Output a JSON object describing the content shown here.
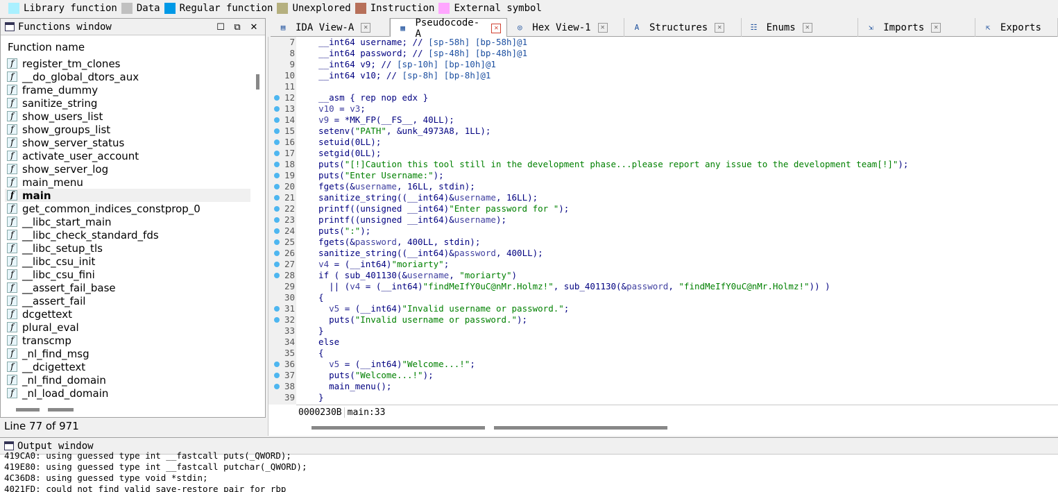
{
  "legend": [
    {
      "label": "Library function",
      "color": "#a9f0ff"
    },
    {
      "label": "Data",
      "color": "#c0c0c0"
    },
    {
      "label": "Regular function",
      "color": "#0099e6"
    },
    {
      "label": "Unexplored",
      "color": "#b5b07f"
    },
    {
      "label": "Instruction",
      "color": "#b7705a"
    },
    {
      "label": "External symbol",
      "color": "#ffa6ff"
    }
  ],
  "functions_window": {
    "title": "Functions window",
    "column_header": "Function name",
    "selected": "main",
    "items": [
      "register_tm_clones",
      "__do_global_dtors_aux",
      "frame_dummy",
      "sanitize_string",
      "show_users_list",
      "show_groups_list",
      "show_server_status",
      "activate_user_account",
      "show_server_log",
      "main_menu",
      "main",
      "get_common_indices_constprop_0",
      "__libc_start_main",
      "__libc_check_standard_fds",
      "__libc_setup_tls",
      "__libc_csu_init",
      "__libc_csu_fini",
      "__assert_fail_base",
      "__assert_fail",
      "dcgettext",
      "plural_eval",
      "transcmp",
      "_nl_find_msg",
      "__dcigettext",
      "_nl_find_domain",
      "_nl_load_domain"
    ],
    "status": "Line 77 of 971"
  },
  "tabs": [
    {
      "label": "IDA View-A",
      "icon": "ida-view-icon",
      "glyph": "▤",
      "active": false
    },
    {
      "label": "Pseudocode-A",
      "icon": "pseudocode-icon",
      "glyph": "▦",
      "active": true
    },
    {
      "label": "Hex View-1",
      "icon": "hex-view-icon",
      "glyph": "◎",
      "active": false
    },
    {
      "label": "Structures",
      "icon": "structures-icon",
      "glyph": "A",
      "active": false
    },
    {
      "label": "Enums",
      "icon": "enums-icon",
      "glyph": "☷",
      "active": false
    },
    {
      "label": "Imports",
      "icon": "imports-icon",
      "glyph": "⇲",
      "active": false
    },
    {
      "label": "Exports",
      "icon": "exports-icon",
      "glyph": "⇱",
      "active": false
    }
  ],
  "code": {
    "lines": [
      {
        "n": "7",
        "dot": false,
        "html": "  <span class='kw'>__int64 username; // </span><span class='cm'>[sp-58h] [bp-58h]@1</span>"
      },
      {
        "n": "8",
        "dot": false,
        "html": "  <span class='kw'>__int64 password; // </span><span class='cm'>[sp-48h] [bp-48h]@1</span>"
      },
      {
        "n": "9",
        "dot": false,
        "html": "  <span class='kw'>__int64 v9; // </span><span class='cm'>[sp-10h] [bp-10h]@1</span>"
      },
      {
        "n": "10",
        "dot": false,
        "html": "  <span class='kw'>__int64 v10; // </span><span class='cm'>[sp-8h] [bp-8h]@1</span>"
      },
      {
        "n": "11",
        "dot": false,
        "html": ""
      },
      {
        "n": "12",
        "dot": true,
        "html": "  __asm { rep nop edx }"
      },
      {
        "n": "13",
        "dot": true,
        "html": "  <span class='var'>v10</span> = <span class='var'>v3</span>;"
      },
      {
        "n": "14",
        "dot": true,
        "html": "  <span class='var'>v9</span> = *MK_FP(__FS__, 40LL);"
      },
      {
        "n": "15",
        "dot": true,
        "html": "  setenv(<span class='str'>\"PATH\"</span>, &amp;unk_4973A8, 1LL);"
      },
      {
        "n": "16",
        "dot": true,
        "html": "  setuid(0LL);"
      },
      {
        "n": "17",
        "dot": true,
        "html": "  setgid(0LL);"
      },
      {
        "n": "18",
        "dot": true,
        "html": "  puts(<span class='str'>\"[!]Caution this tool still in the development phase...please report any issue to the development team[!]\"</span>);"
      },
      {
        "n": "19",
        "dot": true,
        "html": "  puts(<span class='str'>\"Enter Username:\"</span>);"
      },
      {
        "n": "20",
        "dot": true,
        "html": "  fgets(&amp;<span class='var'>username</span>, 16LL, stdin);"
      },
      {
        "n": "21",
        "dot": true,
        "html": "  sanitize_string((__int64)&amp;<span class='var'>username</span>, 16LL);"
      },
      {
        "n": "22",
        "dot": true,
        "html": "  printf((unsigned __int64)<span class='str'>\"Enter password for \"</span>);"
      },
      {
        "n": "23",
        "dot": true,
        "html": "  printf((unsigned __int64)&amp;<span class='var'>username</span>);"
      },
      {
        "n": "24",
        "dot": true,
        "html": "  puts(<span class='str'>\":\"</span>);"
      },
      {
        "n": "25",
        "dot": true,
        "html": "  fgets(&amp;<span class='var'>password</span>, 400LL, stdin);"
      },
      {
        "n": "26",
        "dot": true,
        "html": "  sanitize_string((__int64)&amp;<span class='var'>password</span>, 400LL);"
      },
      {
        "n": "27",
        "dot": true,
        "html": "  <span class='var'>v4</span> = (__int64)<span class='str'>\"moriarty\"</span>;"
      },
      {
        "n": "28",
        "dot": true,
        "html": "  if ( sub_401130(&amp;<span class='var'>username</span>, <span class='str'>\"moriarty\"</span>)"
      },
      {
        "n": "29",
        "dot": false,
        "html": "    || (<span class='var'>v4</span> = (__int64)<span class='str'>\"findMeIfY0uC@nMr.Holmz!\"</span>, sub_401130(&amp;<span class='var'>password</span>, <span class='str'>\"findMeIfY0uC@nMr.Holmz!\"</span>)) )"
      },
      {
        "n": "30",
        "dot": false,
        "html": "  {"
      },
      {
        "n": "31",
        "dot": true,
        "html": "    <span class='var'>v5</span> = (__int64)<span class='str'>\"Invalid username or password.\"</span>;"
      },
      {
        "n": "32",
        "dot": true,
        "html": "    puts(<span class='str'>\"Invalid username or password.\"</span>);"
      },
      {
        "n": "33",
        "dot": false,
        "html": "  }"
      },
      {
        "n": "34",
        "dot": false,
        "html": "  else"
      },
      {
        "n": "35",
        "dot": false,
        "html": "  {"
      },
      {
        "n": "36",
        "dot": true,
        "html": "    <span class='var'>v5</span> = (__int64)<span class='str'>\"Welcome...!\"</span>;"
      },
      {
        "n": "37",
        "dot": true,
        "html": "    puts(<span class='str'>\"Welcome...!\"</span>);"
      },
      {
        "n": "38",
        "dot": true,
        "html": "    main_menu();"
      },
      {
        "n": "39",
        "dot": false,
        "html": "  }"
      }
    ],
    "status_address": "0000230B",
    "status_location": "main:33"
  },
  "output_window": {
    "title": "Output window",
    "lines": [
      "419CA0: using guessed type int __fastcall puts(_QWORD);",
      "419E80: using guessed type int __fastcall putchar(_QWORD);",
      "4C36D8: using guessed type void *stdin;",
      "4021FD: could not find valid save-restore pair for rbp"
    ]
  }
}
